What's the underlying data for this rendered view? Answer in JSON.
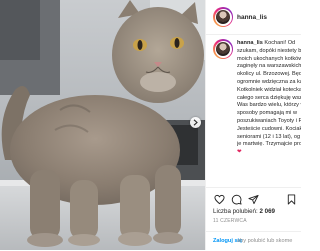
{
  "post": {
    "username": "hanna_lis",
    "caption_lines": [
      "Kochani! Od",
      "szukam, dopóki niestety be",
      "moich ukochanych kotków",
      "zaginęły na warszawskich",
      "okolicy ul. Brzozowej. Będ",
      "ogromnie wdzięczna za ka",
      "Kotkolniek widział kotecka",
      "całego serca dziękuję wszy",
      "Was bardzo wielu, którzy v",
      "sposoby pomagają mi w",
      "poszukiwaniach Toyoty i F",
      "Jesteście cudowni. Kociaki",
      "seniorami (12 i 13 lat), og",
      "je martwię. Trzymajcie proc",
      "❤"
    ],
    "likes_label": "Liczba polubień:",
    "likes_count": "2 069",
    "date": "11 CZERWCA"
  },
  "login_bar": {
    "link": "Zaloguj się",
    "text": "aby polubić lub skome"
  },
  "icons": {
    "next": "chevron-right-icon",
    "like": "heart-icon",
    "comment": "comment-icon",
    "share": "share-icon",
    "save": "bookmark-icon"
  },
  "colors": {
    "link_blue": "#0095f6",
    "text_dark": "#262626",
    "text_muted": "#8e8e8e",
    "border": "#efefef"
  }
}
